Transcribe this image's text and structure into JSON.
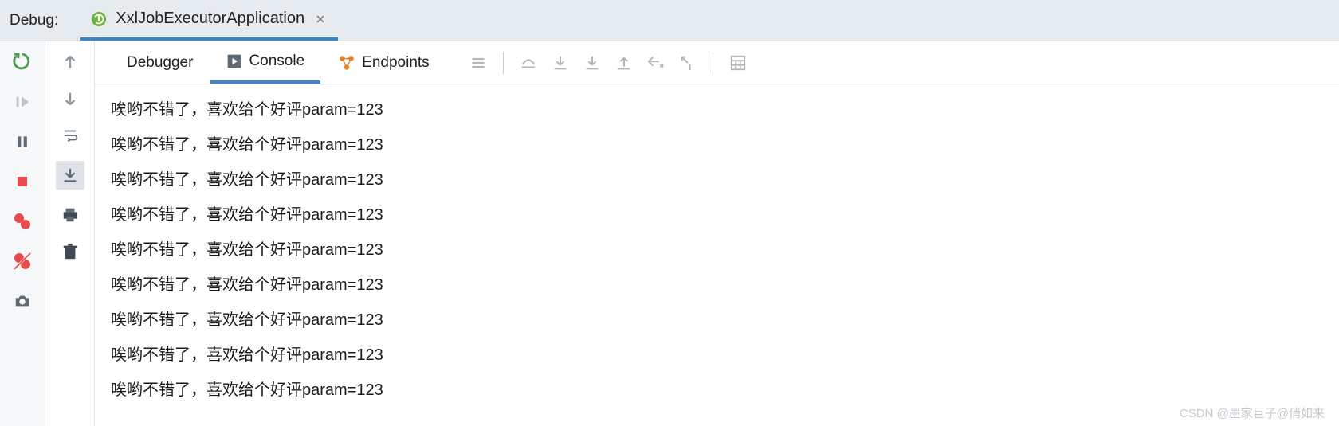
{
  "header": {
    "debug_label": "Debug:",
    "run_tab_title": "XxlJobExecutorApplication"
  },
  "sub_tabs": {
    "debugger": "Debugger",
    "console": "Console",
    "endpoints": "Endpoints"
  },
  "console": {
    "lines": [
      "唉哟不错了，喜欢给个好评param=123",
      "唉哟不错了，喜欢给个好评param=123",
      "唉哟不错了，喜欢给个好评param=123",
      "唉哟不错了，喜欢给个好评param=123",
      "唉哟不错了，喜欢给个好评param=123",
      "唉哟不错了，喜欢给个好评param=123",
      "唉哟不错了，喜欢给个好评param=123",
      "唉哟不错了，喜欢给个好评param=123",
      "唉哟不错了，喜欢给个好评param=123"
    ]
  },
  "watermark": "CSDN @墨家巨子@俏如来"
}
